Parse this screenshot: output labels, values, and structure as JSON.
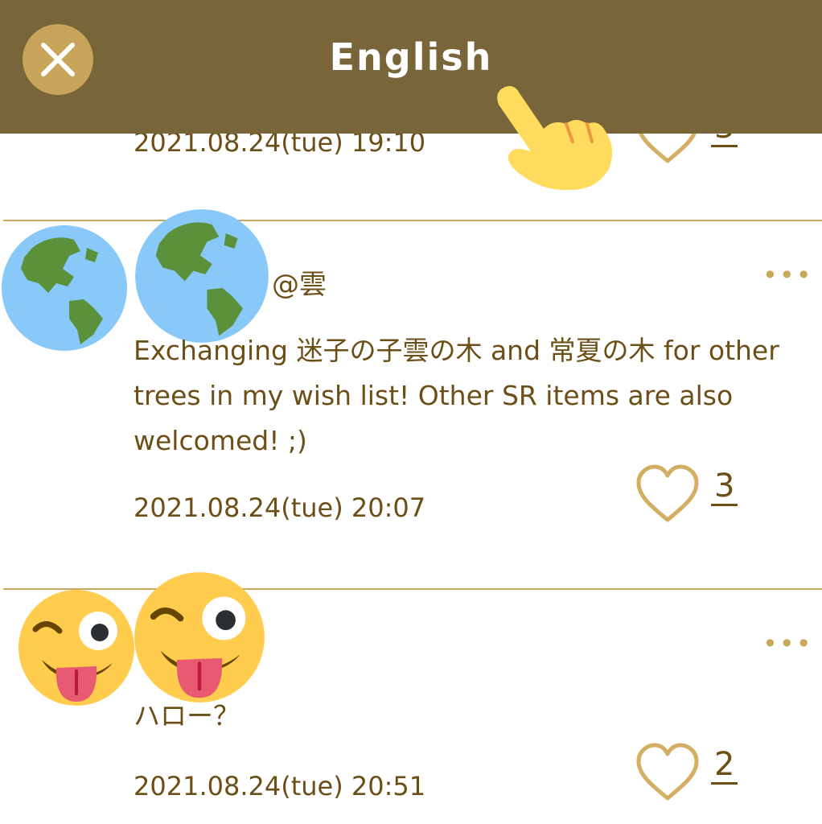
{
  "header": {
    "title": "English",
    "close_icon": "close-icon",
    "accent_color": "#78653a",
    "close_bg_color": "#c8a45a"
  },
  "overlay": {
    "pointer_icon": "pointing-hand-icon"
  },
  "posts": [
    {
      "timestamp": "2021.08.24(tue) 19:10",
      "like_count": "3"
    },
    {
      "avatar_icon": "globe-americas-icon",
      "username": "@雲",
      "body": "Exchanging 迷子の子雲の木 and 常夏の木 for other trees in my wish list! Other SR items are also welcomed! ;)",
      "timestamp": "2021.08.24(tue) 20:07",
      "like_count": "3"
    },
    {
      "avatar_icon": "winking-face-with-tongue-icon",
      "username": "",
      "body": "ハロー？",
      "timestamp": "2021.08.24(tue) 20:51",
      "like_count": "2"
    }
  ],
  "more_label": "•••",
  "like_icon": "heart-outline-icon",
  "text_color": "#6b4f17",
  "divider_color": "#c9a85c"
}
